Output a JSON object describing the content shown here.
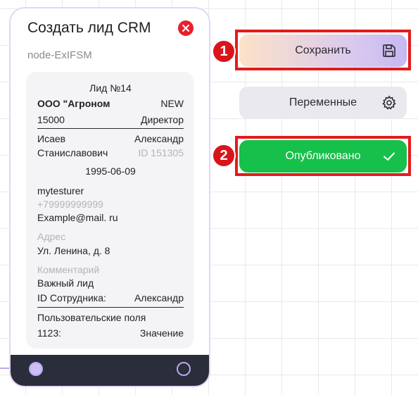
{
  "node": {
    "title": "Создать лид CRM",
    "id_label": "node-ExIFSM",
    "card": {
      "lead_title": "Лид №14",
      "company": "ООО \"Агроном",
      "status": "NEW",
      "amount": "15000",
      "position": "Директор",
      "last_name": "Исаев",
      "first_name": "Александр",
      "middle_name": "Станиславович",
      "lead_id": "ID 151305",
      "birth_date": "1995-06-09",
      "login": "mytesturer",
      "phone": "+79999999999",
      "email": "Example@mail. ru",
      "address_label": "Адрес",
      "address": "Ул. Ленина, д. 8",
      "comment_label": "Комментарий",
      "comment": "Важный лид",
      "employee_label": "ID Сотрудника:",
      "employee_value": "Александр",
      "custom_fields_label": "Пользовательские поля",
      "custom_key": "1123:",
      "custom_value": "Значение"
    }
  },
  "actions": {
    "save_label": "Сохранить",
    "variables_label": "Переменные",
    "publish_label": "Опубликовано"
  },
  "markers": {
    "first": "1",
    "second": "2"
  },
  "icons": {
    "close": "close-icon",
    "save": "floppy-disk-icon",
    "variables": "gear-icon",
    "publish": "checkmark-icon"
  },
  "colors": {
    "publish": "#16c04a",
    "highlight": "#e31b1b",
    "close": "#e8202c",
    "node_footer": "#2a2d3a"
  }
}
